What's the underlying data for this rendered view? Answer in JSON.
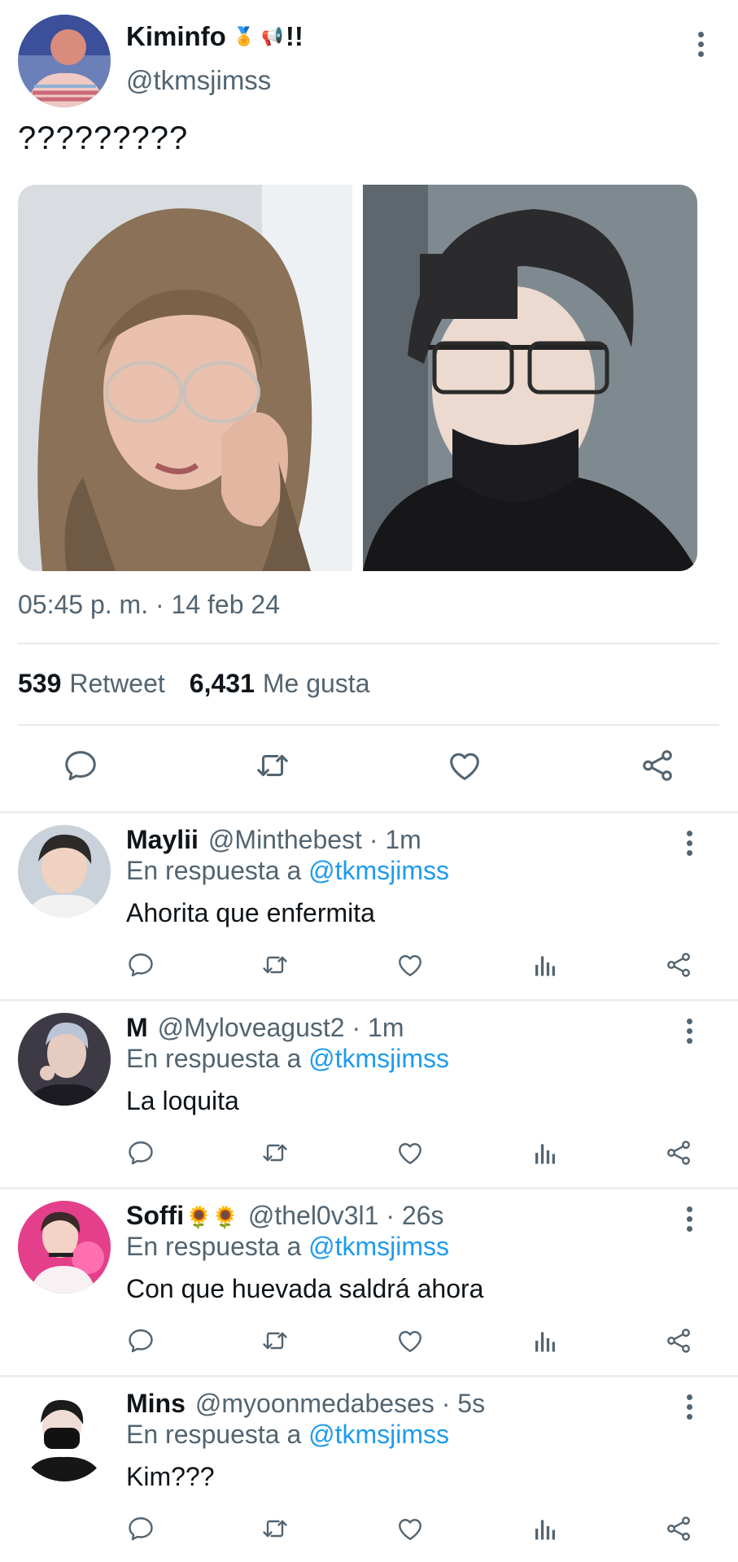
{
  "tweet": {
    "author_name": "Kiminfo",
    "author_emoji_1": "🏅",
    "author_emoji_2": "📢",
    "author_suffix": "!!",
    "handle": "@tkmsjimss",
    "text": "?????????",
    "timestamp": "05:45 p. m. · 14 feb 24",
    "retweets_count": "539",
    "retweets_label": "Retweet",
    "likes_count": "6,431",
    "likes_label": "Me gusta"
  },
  "replies": [
    {
      "name": "Maylii",
      "name_emoji": "",
      "handle_time": "@Minthebest · 1m",
      "replying_prefix": "En respuesta a",
      "replying_to": "@tkmsjimss",
      "text": "Ahorita que enfermita"
    },
    {
      "name": "M",
      "name_emoji": "",
      "handle_time": "@Myloveagust2 · 1m",
      "replying_prefix": "En respuesta a",
      "replying_to": "@tkmsjimss",
      "text": "La loquita"
    },
    {
      "name": "Soffi",
      "name_emoji": "🌻🌻",
      "handle_time": "@thel0v3l1 · 26s",
      "replying_prefix": "En respuesta a",
      "replying_to": "@tkmsjimss",
      "text": "Con que huevada saldrá ahora"
    },
    {
      "name": "Mins",
      "name_emoji": "",
      "handle_time": "@myoonmedabeses · 5s",
      "replying_prefix": "En respuesta a",
      "replying_to": "@tkmsjimss",
      "text": "Kim???"
    }
  ],
  "icons": {
    "reply": "speech-bubble-icon",
    "retweet": "retweet-icon",
    "like": "heart-icon",
    "views": "bar-chart-icon",
    "share": "share-icon",
    "more": "vertical-dots-icon"
  },
  "colors": {
    "text_primary": "#0f1419",
    "text_secondary": "#536471",
    "accent": "#1d9bf0",
    "divider": "#e6e9ec"
  }
}
